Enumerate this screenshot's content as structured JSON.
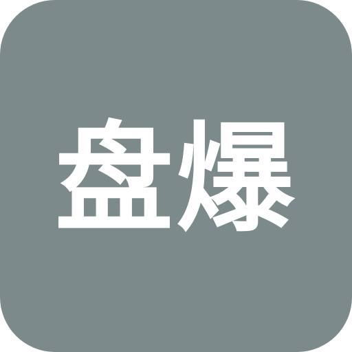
{
  "icon": {
    "label": "盘爆",
    "background_color": "#7d8a8b",
    "text_color": "#ffffff"
  }
}
